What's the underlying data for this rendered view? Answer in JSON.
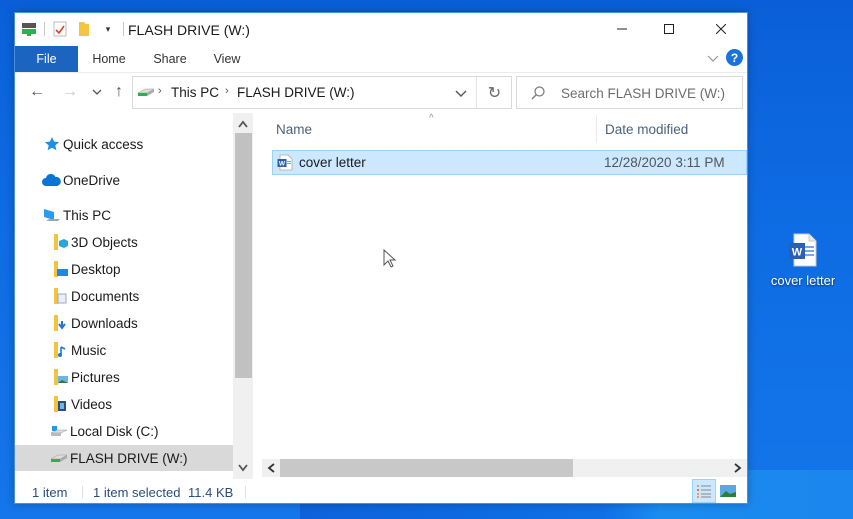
{
  "window": {
    "title": "FLASH DRIVE (W:)",
    "controls": {
      "minimize": "–",
      "maximize": "☐",
      "close": "✕"
    }
  },
  "quick_access_toolbar": {
    "icons": [
      "drive-icon",
      "properties-icon",
      "new-folder-icon",
      "customize-dropdown-icon"
    ]
  },
  "ribbon": {
    "tabs": [
      {
        "label": "File",
        "active": true
      },
      {
        "label": "Home"
      },
      {
        "label": "Share"
      },
      {
        "label": "View"
      }
    ],
    "help_label": "?"
  },
  "navigation": {
    "back": "←",
    "forward": "→",
    "recent": "⌄",
    "up": "↑",
    "breadcrumb": [
      "This PC",
      "FLASH DRIVE (W:)"
    ],
    "breadcrumb_separator": "›",
    "dropdown": "⌄",
    "refresh": "↻",
    "search_placeholder": "Search FLASH DRIVE (W:)"
  },
  "sidebar": {
    "items": [
      {
        "label": "Quick access",
        "icon": "star-icon",
        "level": 0
      },
      {
        "label": "OneDrive",
        "icon": "cloud-icon",
        "level": 0
      },
      {
        "label": "This PC",
        "icon": "computer-icon",
        "level": 0
      },
      {
        "label": "3D Objects",
        "icon": "3d-objects-folder-icon",
        "level": 1
      },
      {
        "label": "Desktop",
        "icon": "desktop-folder-icon",
        "level": 1
      },
      {
        "label": "Documents",
        "icon": "documents-folder-icon",
        "level": 1
      },
      {
        "label": "Downloads",
        "icon": "downloads-folder-icon",
        "level": 1
      },
      {
        "label": "Music",
        "icon": "music-folder-icon",
        "level": 1
      },
      {
        "label": "Pictures",
        "icon": "pictures-folder-icon",
        "level": 1
      },
      {
        "label": "Videos",
        "icon": "videos-folder-icon",
        "level": 1
      },
      {
        "label": "Local Disk (C:)",
        "icon": "local-disk-icon",
        "level": 1
      },
      {
        "label": "FLASH DRIVE (W:)",
        "icon": "flash-drive-icon",
        "level": 1,
        "selected": true
      }
    ]
  },
  "file_list": {
    "columns": [
      "Name",
      "Date modified"
    ],
    "sort_indicator": "^",
    "rows": [
      {
        "name": "cover letter",
        "date_modified": "12/28/2020 3:11 PM",
        "icon": "word-document-icon",
        "selected": true
      }
    ]
  },
  "status_bar": {
    "item_count": "1 item",
    "selection": "1 item selected",
    "size": "11.4 KB"
  },
  "desktop": {
    "icons": [
      {
        "label": "cover letter",
        "icon": "word-document-icon"
      }
    ]
  },
  "colors": {
    "accent": "#1b64c0",
    "selection_bg": "#cce8ff",
    "selection_border": "#99d1ff",
    "desktop_bg": "#0e6be3"
  }
}
